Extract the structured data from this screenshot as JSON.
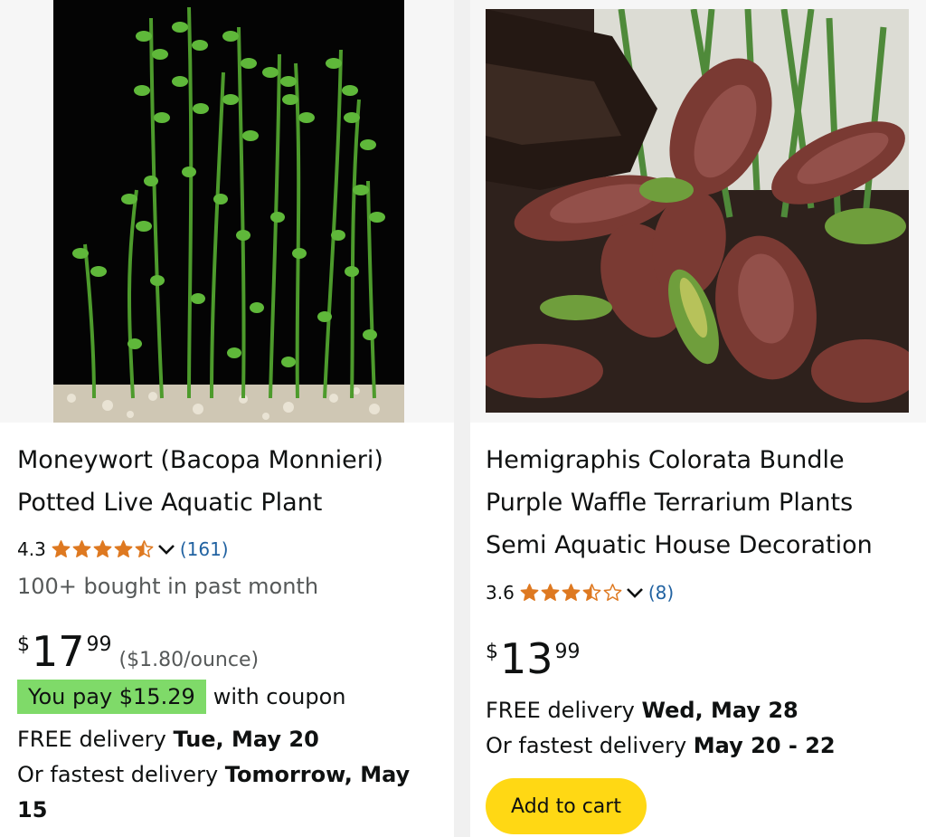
{
  "products": [
    {
      "title": "Moneywort (Bacopa Monnieri) Potted Live Aquatic Plant",
      "image_icon": "moneywort-plant-photo",
      "rating_value": "4.3",
      "rating_stars": 4.5,
      "review_count": "(161)",
      "bought_text": "100+ bought in past month",
      "price_symbol": "$",
      "price_whole": "17",
      "price_fraction": "99",
      "unit_price": "($1.80/ounce)",
      "coupon_label": "You pay $15.29",
      "coupon_suffix": "with coupon",
      "delivery_prefix": "FREE delivery ",
      "delivery_date": "Tue, May 20",
      "fastest_prefix": "Or fastest delivery ",
      "fastest_date": "Tomorrow, May 15"
    },
    {
      "title": "Hemigraphis Colorata Bundle Purple Waffle Terrarium Plants Semi Aquatic House Decoration",
      "image_icon": "purple-waffle-plant-photo",
      "rating_value": "3.6",
      "rating_stars": 3.5,
      "review_count": "(8)",
      "price_symbol": "$",
      "price_whole": "13",
      "price_fraction": "99",
      "delivery_prefix": "FREE delivery ",
      "delivery_date": "Wed, May 28",
      "fastest_prefix": "Or fastest delivery ",
      "fastest_date": "May 20 - 22",
      "add_to_cart_label": "Add to cart"
    }
  ],
  "colors": {
    "star": "#de7921",
    "link": "#2162a1",
    "coupon_bg": "#7fda69",
    "cart_button": "#ffd814",
    "secondary_text": "#565959"
  }
}
